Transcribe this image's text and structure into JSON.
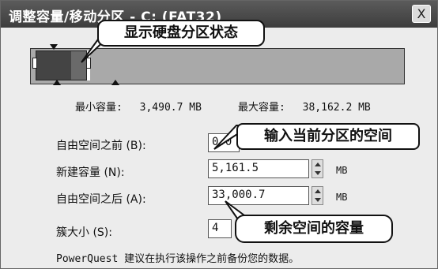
{
  "window": {
    "title": "调整容量/移动分区 - C: (FAT32)",
    "close_label": "X"
  },
  "sizes": {
    "min_label": "最小容量:",
    "min_value": "3,490.7 MB",
    "max_label": "最大容量:",
    "max_value": "38,162.2 MB"
  },
  "fields": [
    {
      "label": "自由空间之前 (B):",
      "value": "0.0",
      "unit": ""
    },
    {
      "label": "新建容量 (N):",
      "value": "5,161.5",
      "unit": "MB"
    },
    {
      "label": "自由空间之后 (A):",
      "value": "33,000.7",
      "unit": "MB"
    },
    {
      "label": "簇大小 (S):",
      "value": "4",
      "unit": ""
    }
  ],
  "footer_note": "PowerQuest 建议在执行该操作之前备份您的数据。",
  "callouts": {
    "disk_status": "显示硬盘分区状态",
    "current_partition": "输入当前分区的空间",
    "remaining_space": "剩余空间的容量"
  },
  "partition": {
    "used_fraction": 0.135
  }
}
